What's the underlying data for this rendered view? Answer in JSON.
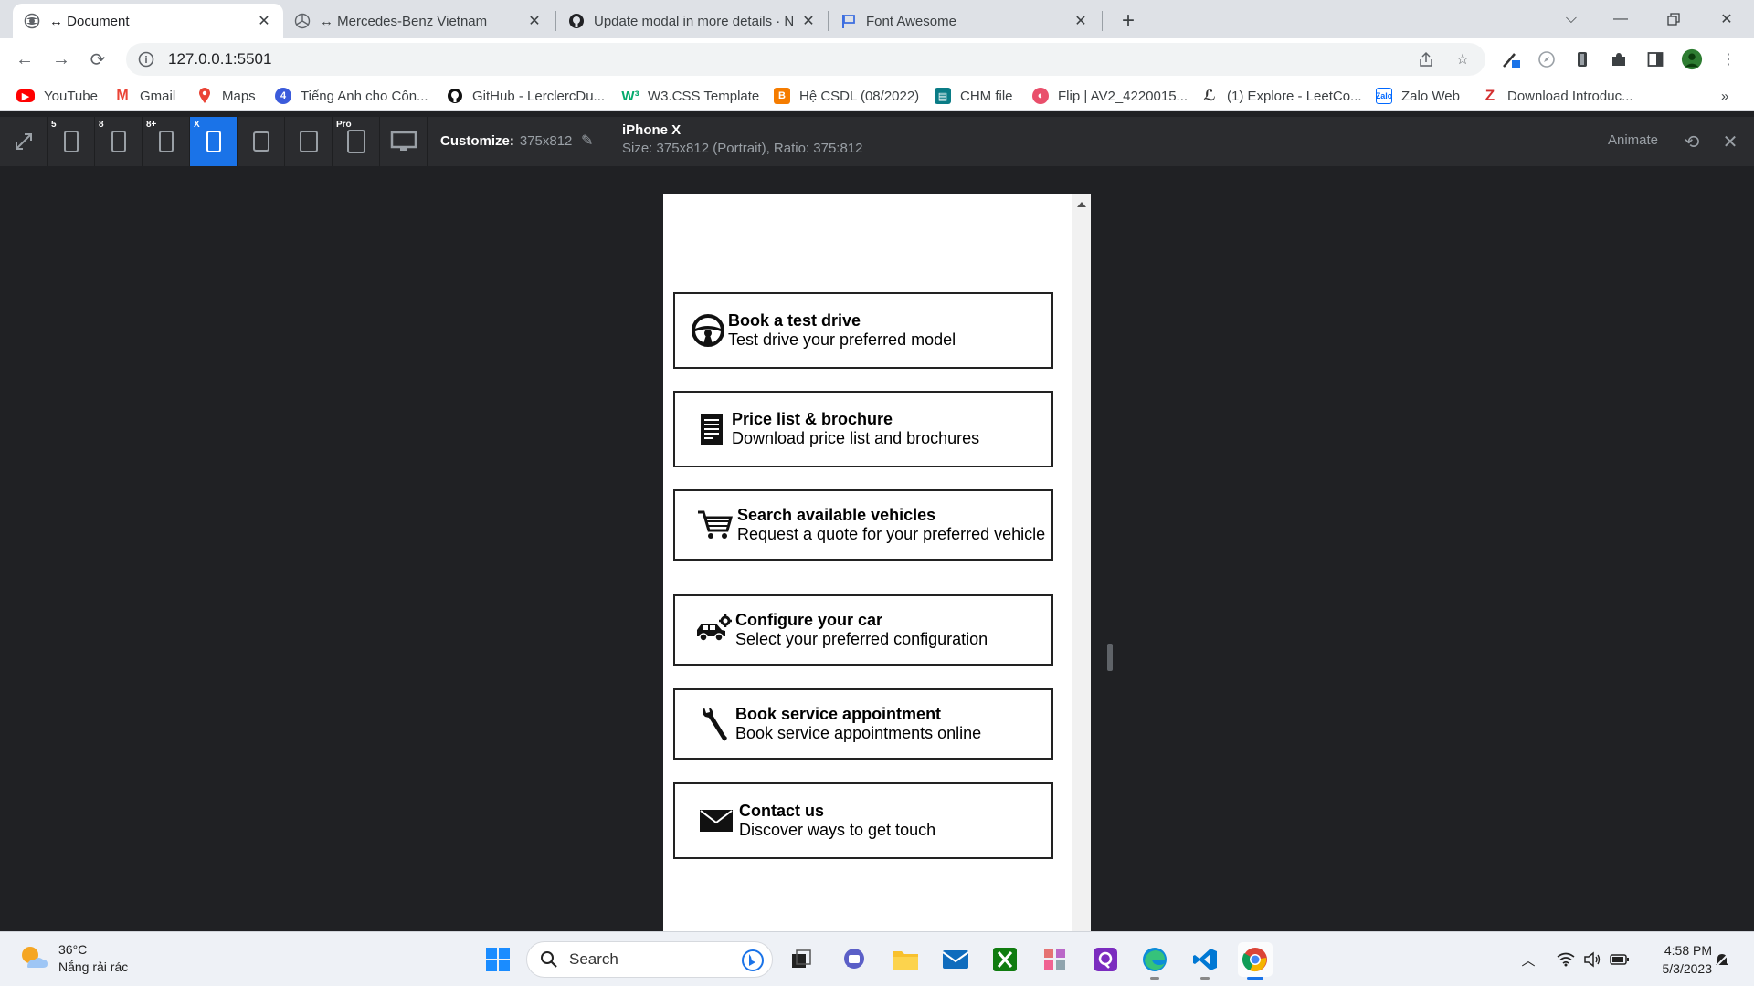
{
  "tabs": [
    {
      "label": "↔ Document",
      "active": true,
      "icon": "globe-icon"
    },
    {
      "label": "↔ Mercedes-Benz Vietnam",
      "active": false,
      "icon": "mercedes-icon"
    },
    {
      "label": "Update modal in more details · N",
      "active": false,
      "icon": "github-icon"
    },
    {
      "label": "Font Awesome",
      "active": false,
      "icon": "flag-icon"
    }
  ],
  "address": {
    "url": "127.0.0.1:5501"
  },
  "bookmarks": [
    {
      "label": "YouTube",
      "icon": "youtube-icon",
      "color": "#ff0000"
    },
    {
      "label": "Gmail",
      "icon": "gmail-icon",
      "color": "#ea4335"
    },
    {
      "label": "Maps",
      "icon": "maps-icon",
      "color": "#34a853"
    },
    {
      "label": "Tiếng Anh cho Côn...",
      "icon": "english-icon",
      "color": "#3b5bdb"
    },
    {
      "label": "GitHub - LerclercDu...",
      "icon": "github-icon",
      "color": "#111111"
    },
    {
      "label": "W3.CSS Template",
      "icon": "w3-icon",
      "color": "#04aa6d"
    },
    {
      "label": "Hệ CSDL (08/2022)",
      "icon": "blogger-icon",
      "color": "#f57c00"
    },
    {
      "label": "CHM file",
      "icon": "chm-icon",
      "color": "#0a7c86"
    },
    {
      "label": "Flip | AV2_4220015...",
      "icon": "flip-icon",
      "color": "#e94f6b"
    },
    {
      "label": "(1) Explore - LeetCo...",
      "icon": "leetcode-icon",
      "color": "#ffa116"
    },
    {
      "label": "Zalo Web",
      "icon": "zalo-icon",
      "color": "#0068ff"
    },
    {
      "label": "Download Introduc...",
      "icon": "z-icon",
      "color": "#d32f2f"
    }
  ],
  "devtools": {
    "badges": [
      "5",
      "8",
      "8+",
      "X",
      "",
      "",
      "Pro"
    ],
    "customize_label": "Customize:",
    "customize_value": "375x812",
    "device_name": "iPhone X",
    "device_info": "Size: 375x812 (Portrait), Ratio: 375:812",
    "animate_label": "Animate"
  },
  "cards": [
    {
      "title": "Book a test drive",
      "subtitle": "Test drive your preferred model",
      "icon": "steering-wheel-icon"
    },
    {
      "title": "Price list & brochure",
      "subtitle": "Download price list and brochures",
      "icon": "document-icon"
    },
    {
      "title": "Search available vehicles",
      "subtitle": "Request a quote for your preferred vehicle",
      "icon": "cart-icon"
    },
    {
      "title": "Configure your car",
      "subtitle": "Select your preferred configuration",
      "icon": "car-gear-icon"
    },
    {
      "title": "Book service appointment",
      "subtitle": "Book service appointments online",
      "icon": "wrench-icon"
    },
    {
      "title": "Contact us",
      "subtitle": "Discover ways to get touch",
      "icon": "envelope-icon"
    }
  ],
  "taskbar": {
    "weather_temp": "36°C",
    "weather_desc": "Nắng rải rác",
    "search_label": "Search",
    "time": "4:58 PM",
    "date": "5/3/2023"
  }
}
